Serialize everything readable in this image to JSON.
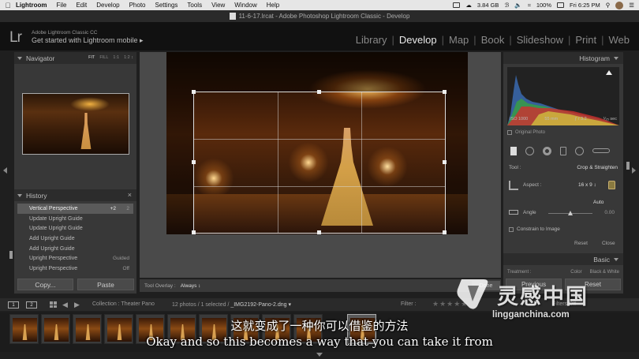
{
  "menubar": {
    "app": "Lightroom",
    "menus": [
      "File",
      "Edit",
      "Develop",
      "Photo",
      "Settings",
      "Tools",
      "View",
      "Window",
      "Help"
    ],
    "memory": "3.84 GB",
    "battery": "100%",
    "time": "Fri 6:25 PM"
  },
  "window": {
    "title": "11-6-17.lrcat - Adobe Photoshop Lightroom Classic - Develop"
  },
  "identity": {
    "logo": "Lr",
    "line1": "Adobe Lightroom Classic CC",
    "line2": "Get started with Lightroom mobile ▸"
  },
  "modules": [
    "Library",
    "Develop",
    "Map",
    "Book",
    "Slideshow",
    "Print",
    "Web"
  ],
  "navigator": {
    "title": "Navigator",
    "zoom": [
      "FIT",
      "FILL",
      "1:1",
      "1:2 ↕"
    ]
  },
  "history": {
    "title": "History",
    "close": "×",
    "items": [
      {
        "label": "Vertical Perspective",
        "a": "+2",
        "b": "2"
      },
      {
        "label": "Update Upright Guide",
        "a": "",
        "b": ""
      },
      {
        "label": "Update Upright Guide",
        "a": "",
        "b": ""
      },
      {
        "label": "Add Upright Guide",
        "a": "",
        "b": ""
      },
      {
        "label": "Add Upright Guide",
        "a": "",
        "b": ""
      },
      {
        "label": "Upright Perspective",
        "a": "",
        "b": "Guided"
      },
      {
        "label": "Upright Perspective",
        "a": "",
        "b": "Off"
      }
    ]
  },
  "left_buttons": {
    "copy": "Copy...",
    "paste": "Paste"
  },
  "toolbar": {
    "label": "Tool Overlay :",
    "value": "Always ↕",
    "done": "Done"
  },
  "histogram": {
    "title": "Histogram",
    "iso": "ISO 1000",
    "focal": "55 mm",
    "aperture": "ƒ / 3.2",
    "shutter": "¹⁄₂₅ sec",
    "original": "Original Photo"
  },
  "crop_tool": {
    "tool_label": "Tool :",
    "tool_value": "Crop & Straighten",
    "aspect_label": "Aspect :",
    "aspect_value": "16 x 9 ↕",
    "auto": "Auto",
    "angle_label": "Angle",
    "angle_value": "0.00",
    "angle_fraction": 0.5,
    "constrain": "Constrain to Image",
    "reset": "Reset",
    "close": "Close"
  },
  "basic": {
    "title": "Basic",
    "treatment": "Treatment :",
    "color": "Color",
    "bw": "Black & White"
  },
  "right_buttons": {
    "previous": "Previous",
    "reset": "Reset"
  },
  "filmstrip_bar": {
    "screen1": "1",
    "screen2": "2",
    "source": "Collection : Theater Pano",
    "count": "12 photos / 1 selected /",
    "filename": "_IMG2192-Pano-2.dng ▾",
    "filter": "Filter :",
    "stars": "★★★★★",
    "filters_off": "Filters Off"
  },
  "subtitles": {
    "cn": "这就变成了一种你可以借鉴的方法",
    "en": "Okay and so this becomes a way that you can take it from"
  },
  "watermark": {
    "cn": "灵感中国",
    "url": "lingganchina.com"
  },
  "colors": {
    "accent": "#e8e8e8",
    "panel": "#383838",
    "header": "#2c2c2c"
  }
}
